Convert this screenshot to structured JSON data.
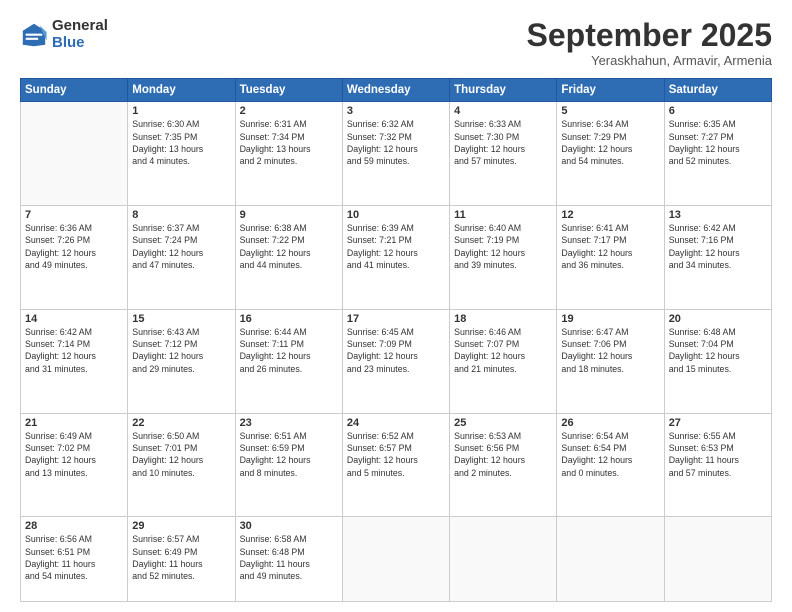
{
  "logo": {
    "general": "General",
    "blue": "Blue"
  },
  "header": {
    "month": "September 2025",
    "location": "Yeraskhahun, Armavir, Armenia"
  },
  "weekdays": [
    "Sunday",
    "Monday",
    "Tuesday",
    "Wednesday",
    "Thursday",
    "Friday",
    "Saturday"
  ],
  "weeks": [
    [
      {
        "day": "",
        "info": ""
      },
      {
        "day": "1",
        "info": "Sunrise: 6:30 AM\nSunset: 7:35 PM\nDaylight: 13 hours\nand 4 minutes."
      },
      {
        "day": "2",
        "info": "Sunrise: 6:31 AM\nSunset: 7:34 PM\nDaylight: 13 hours\nand 2 minutes."
      },
      {
        "day": "3",
        "info": "Sunrise: 6:32 AM\nSunset: 7:32 PM\nDaylight: 12 hours\nand 59 minutes."
      },
      {
        "day": "4",
        "info": "Sunrise: 6:33 AM\nSunset: 7:30 PM\nDaylight: 12 hours\nand 57 minutes."
      },
      {
        "day": "5",
        "info": "Sunrise: 6:34 AM\nSunset: 7:29 PM\nDaylight: 12 hours\nand 54 minutes."
      },
      {
        "day": "6",
        "info": "Sunrise: 6:35 AM\nSunset: 7:27 PM\nDaylight: 12 hours\nand 52 minutes."
      }
    ],
    [
      {
        "day": "7",
        "info": "Sunrise: 6:36 AM\nSunset: 7:26 PM\nDaylight: 12 hours\nand 49 minutes."
      },
      {
        "day": "8",
        "info": "Sunrise: 6:37 AM\nSunset: 7:24 PM\nDaylight: 12 hours\nand 47 minutes."
      },
      {
        "day": "9",
        "info": "Sunrise: 6:38 AM\nSunset: 7:22 PM\nDaylight: 12 hours\nand 44 minutes."
      },
      {
        "day": "10",
        "info": "Sunrise: 6:39 AM\nSunset: 7:21 PM\nDaylight: 12 hours\nand 41 minutes."
      },
      {
        "day": "11",
        "info": "Sunrise: 6:40 AM\nSunset: 7:19 PM\nDaylight: 12 hours\nand 39 minutes."
      },
      {
        "day": "12",
        "info": "Sunrise: 6:41 AM\nSunset: 7:17 PM\nDaylight: 12 hours\nand 36 minutes."
      },
      {
        "day": "13",
        "info": "Sunrise: 6:42 AM\nSunset: 7:16 PM\nDaylight: 12 hours\nand 34 minutes."
      }
    ],
    [
      {
        "day": "14",
        "info": "Sunrise: 6:42 AM\nSunset: 7:14 PM\nDaylight: 12 hours\nand 31 minutes."
      },
      {
        "day": "15",
        "info": "Sunrise: 6:43 AM\nSunset: 7:12 PM\nDaylight: 12 hours\nand 29 minutes."
      },
      {
        "day": "16",
        "info": "Sunrise: 6:44 AM\nSunset: 7:11 PM\nDaylight: 12 hours\nand 26 minutes."
      },
      {
        "day": "17",
        "info": "Sunrise: 6:45 AM\nSunset: 7:09 PM\nDaylight: 12 hours\nand 23 minutes."
      },
      {
        "day": "18",
        "info": "Sunrise: 6:46 AM\nSunset: 7:07 PM\nDaylight: 12 hours\nand 21 minutes."
      },
      {
        "day": "19",
        "info": "Sunrise: 6:47 AM\nSunset: 7:06 PM\nDaylight: 12 hours\nand 18 minutes."
      },
      {
        "day": "20",
        "info": "Sunrise: 6:48 AM\nSunset: 7:04 PM\nDaylight: 12 hours\nand 15 minutes."
      }
    ],
    [
      {
        "day": "21",
        "info": "Sunrise: 6:49 AM\nSunset: 7:02 PM\nDaylight: 12 hours\nand 13 minutes."
      },
      {
        "day": "22",
        "info": "Sunrise: 6:50 AM\nSunset: 7:01 PM\nDaylight: 12 hours\nand 10 minutes."
      },
      {
        "day": "23",
        "info": "Sunrise: 6:51 AM\nSunset: 6:59 PM\nDaylight: 12 hours\nand 8 minutes."
      },
      {
        "day": "24",
        "info": "Sunrise: 6:52 AM\nSunset: 6:57 PM\nDaylight: 12 hours\nand 5 minutes."
      },
      {
        "day": "25",
        "info": "Sunrise: 6:53 AM\nSunset: 6:56 PM\nDaylight: 12 hours\nand 2 minutes."
      },
      {
        "day": "26",
        "info": "Sunrise: 6:54 AM\nSunset: 6:54 PM\nDaylight: 12 hours\nand 0 minutes."
      },
      {
        "day": "27",
        "info": "Sunrise: 6:55 AM\nSunset: 6:53 PM\nDaylight: 11 hours\nand 57 minutes."
      }
    ],
    [
      {
        "day": "28",
        "info": "Sunrise: 6:56 AM\nSunset: 6:51 PM\nDaylight: 11 hours\nand 54 minutes."
      },
      {
        "day": "29",
        "info": "Sunrise: 6:57 AM\nSunset: 6:49 PM\nDaylight: 11 hours\nand 52 minutes."
      },
      {
        "day": "30",
        "info": "Sunrise: 6:58 AM\nSunset: 6:48 PM\nDaylight: 11 hours\nand 49 minutes."
      },
      {
        "day": "",
        "info": ""
      },
      {
        "day": "",
        "info": ""
      },
      {
        "day": "",
        "info": ""
      },
      {
        "day": "",
        "info": ""
      }
    ]
  ]
}
